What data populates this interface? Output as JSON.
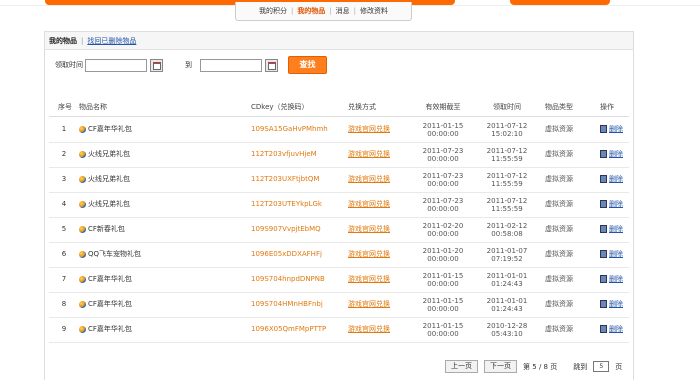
{
  "topnav": {
    "items": [
      "我的积分",
      "我的物品",
      "消息",
      "修改资料"
    ],
    "active": "我的物品"
  },
  "panel": {
    "title": "我的物品",
    "recover_link": "找回已删除物品"
  },
  "filter": {
    "label": "领取时间",
    "to": "到",
    "search": "查找"
  },
  "table": {
    "headers": [
      "序号",
      "物品名称",
      "CDkey（兑换码）",
      "兑换方式",
      "有效期截至",
      "领取时间",
      "物品类型",
      "操作"
    ],
    "rows": [
      {
        "no": "1",
        "name": "CF嘉年华礼包",
        "key": "109SA15GaHvPMhmh",
        "way": "游戏官网兑换",
        "exp_d": "2011-01-15",
        "exp_t": "00:00:00",
        "get_d": "2011-07-12",
        "get_t": "15:02:10",
        "type": "虚拟资源",
        "op": "删除"
      },
      {
        "no": "2",
        "name": "火线兄弟礼包",
        "key": "112T203vfjuvHjeM",
        "way": "游戏官网兑换",
        "exp_d": "2011-07-23",
        "exp_t": "00:00:00",
        "get_d": "2011-07-12",
        "get_t": "11:55:59",
        "type": "虚拟资源",
        "op": "删除"
      },
      {
        "no": "3",
        "name": "火线兄弟礼包",
        "key": "112T203UXFtjbtQM",
        "way": "游戏官网兑换",
        "exp_d": "2011-07-23",
        "exp_t": "00:00:00",
        "get_d": "2011-07-12",
        "get_t": "11:55:59",
        "type": "虚拟资源",
        "op": "删除"
      },
      {
        "no": "4",
        "name": "火线兄弟礼包",
        "key": "112T203UTEYkpLGk",
        "way": "游戏官网兑换",
        "exp_d": "2011-07-23",
        "exp_t": "00:00:00",
        "get_d": "2011-07-12",
        "get_t": "11:55:59",
        "type": "虚拟资源",
        "op": "删除"
      },
      {
        "no": "5",
        "name": "CF新春礼包",
        "key": "109S907VvpjtEbMQ",
        "way": "游戏官网兑换",
        "exp_d": "2011-02-20",
        "exp_t": "00:00:00",
        "get_d": "2011-02-12",
        "get_t": "00:58:08",
        "type": "虚拟资源",
        "op": "删除"
      },
      {
        "no": "6",
        "name": "QQ飞车宠物礼包",
        "key": "1096E05xDDXAFHFj",
        "way": "游戏官网兑换",
        "exp_d": "2011-01-20",
        "exp_t": "00:00:00",
        "get_d": "2011-01-07",
        "get_t": "07:19:52",
        "type": "虚拟资源",
        "op": "删除"
      },
      {
        "no": "7",
        "name": "CF嘉年华礼包",
        "key": "109S704hnpdDNPNB",
        "way": "游戏官网兑换",
        "exp_d": "2011-01-15",
        "exp_t": "00:00:00",
        "get_d": "2011-01-01",
        "get_t": "01:24:43",
        "type": "虚拟资源",
        "op": "删除"
      },
      {
        "no": "8",
        "name": "CF嘉年华礼包",
        "key": "109S704HMnHBFnbj",
        "way": "游戏官网兑换",
        "exp_d": "2011-01-15",
        "exp_t": "00:00:00",
        "get_d": "2011-01-01",
        "get_t": "01:24:43",
        "type": "虚拟资源",
        "op": "删除"
      },
      {
        "no": "9",
        "name": "CF嘉年华礼包",
        "key": "1096X05QmFMpPTTP",
        "way": "游戏官网兑换",
        "exp_d": "2011-01-15",
        "exp_t": "00:00:00",
        "get_d": "2010-12-28",
        "get_t": "05:43:10",
        "type": "虚拟资源",
        "op": "删除"
      }
    ]
  },
  "pager": {
    "prev": "上一页",
    "next": "下一页",
    "di": "第",
    "page": "5",
    "slash": "/",
    "total": "8",
    "ye": "页",
    "goto": "跳到",
    "goto_val": "5",
    "goto_ye": "页"
  }
}
